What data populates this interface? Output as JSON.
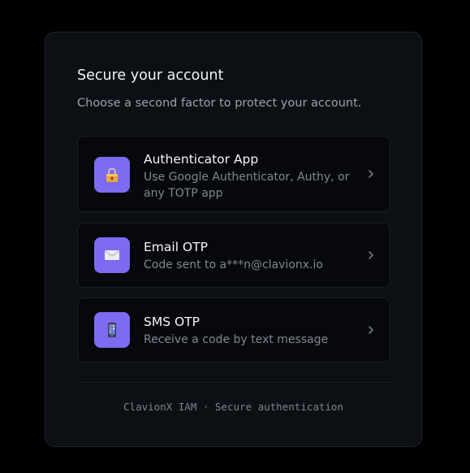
{
  "header": {
    "title": "Secure your account",
    "subtitle": "Choose a second factor to protect your account."
  },
  "options": [
    {
      "title": "Authenticator App",
      "description": "Use Google Authenticator, Authy, or any TOTP app",
      "icon": "lock-icon"
    },
    {
      "title": "Email OTP",
      "description": "Code sent to a***n@clavionx.io",
      "icon": "envelope-icon"
    },
    {
      "title": "SMS OTP",
      "description": "Receive a code by text message",
      "icon": "phone-icon"
    }
  ],
  "footer": {
    "text": "ClavionX IAM · Secure authentication"
  },
  "colors": {
    "background": "#000000",
    "card": "#0c0f14",
    "accent": "#7c6bf0",
    "text_primary": "#f2f4f7",
    "text_secondary": "#7f8893"
  }
}
